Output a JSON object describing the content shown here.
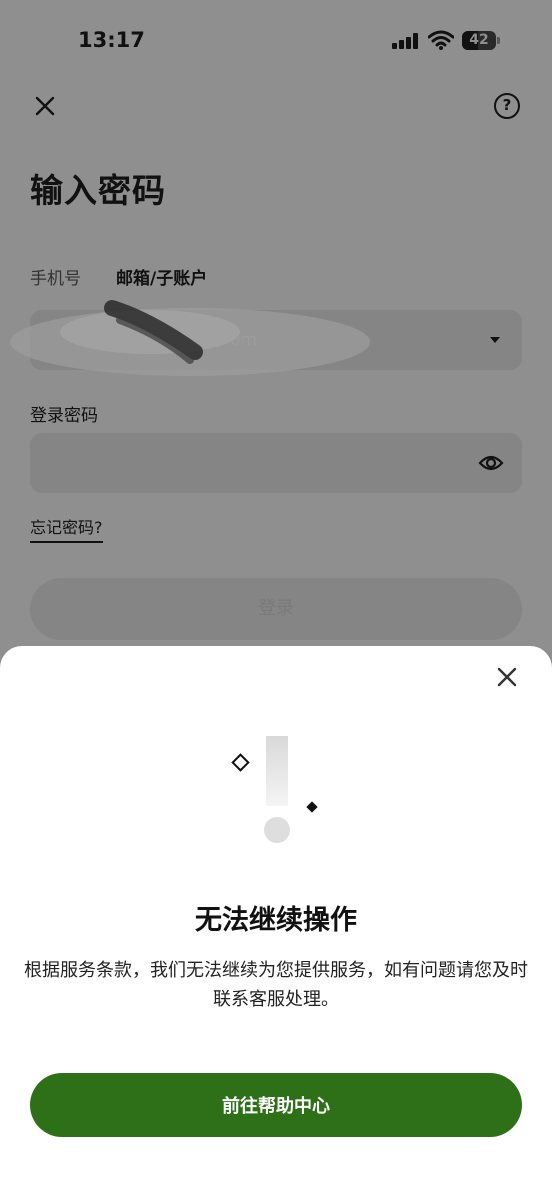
{
  "status_bar": {
    "time": "13:17",
    "battery": "42"
  },
  "header": {
    "close_icon": "close-icon",
    "help_icon": "help-circle-icon"
  },
  "page": {
    "title": "输入密码",
    "tab_phone": "手机号",
    "tab_email": "邮箱/子账户",
    "account_value": "om",
    "password_label": "登录密码",
    "forgot_password": "忘记密码?",
    "login_button": "登录"
  },
  "dialog": {
    "title": "无法继续操作",
    "description": "根据服务条款，我们无法继续为您提供服务，如有问题请您及时联系客服处理。",
    "help_button": "前往帮助中心"
  },
  "colors": {
    "primary": "#2d7018",
    "overlay": "#8f8f8f"
  }
}
